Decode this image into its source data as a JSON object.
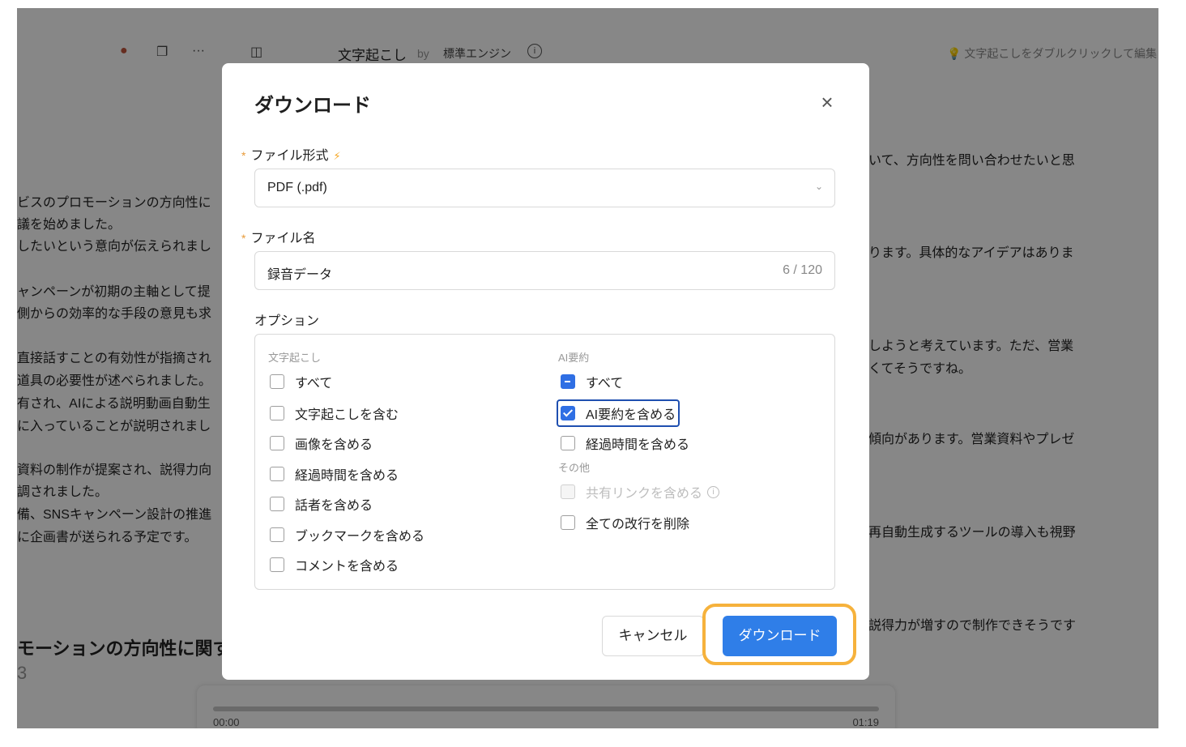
{
  "toolbar": {
    "title": "文字起こし",
    "by": "by",
    "engine": "標準エンジン",
    "hint": "文字起こしをダブルクリックして編集"
  },
  "background_left": [
    "ビスのプロモーションの方向性に",
    "議を始めました。",
    "したいという意向が伝えられまし",
    "ャンペーンが初期の主軸として提",
    "側からの効率的な手段の意見も求",
    "直接話すことの有効性が指摘され",
    "道具の必要性が述べられました。",
    "有され、AIによる説明動画自動生",
    "に入っていることが説明されまし",
    "資料の制作が提案され、説得力向",
    "調されました。",
    "備、SNSキャンペーン設計の推進",
    "に企画書が送られる予定です。"
  ],
  "background_right": [
    "いて、方向性を問い合わせたいと思",
    "ります。具体的なアイデアはありま",
    "しようと考えています。ただ、営業",
    "くてそうですね。",
    "傾向があります。営業資料やプレゼ",
    "再自動生成するツールの導入も視野",
    "説得力が増すので制作できそうです"
  ],
  "background_heading": "モーションの方向性に関す",
  "background_number": "3",
  "player": {
    "start": "00:00",
    "end": "01:19"
  },
  "dialog": {
    "title": "ダウンロード",
    "format_label": "ファイル形式",
    "format_value": "PDF (.pdf)",
    "filename_label": "ファイル名",
    "filename_value": "録音データ",
    "filename_count": "6 / 120",
    "options_label": "オプション",
    "group_transcript": "文字起こし",
    "transcript_options": [
      "すべて",
      "文字起こしを含む",
      "画像を含める",
      "経過時間を含める",
      "話者を含める",
      "ブックマークを含める",
      "コメントを含める"
    ],
    "group_ai": "AI要約",
    "ai_options": [
      "すべて",
      "AI要約を含める",
      "経過時間を含める"
    ],
    "group_other": "その他",
    "other_options": [
      "共有リンクを含める",
      "全ての改行を削除"
    ],
    "cancel": "キャンセル",
    "download": "ダウンロード"
  }
}
